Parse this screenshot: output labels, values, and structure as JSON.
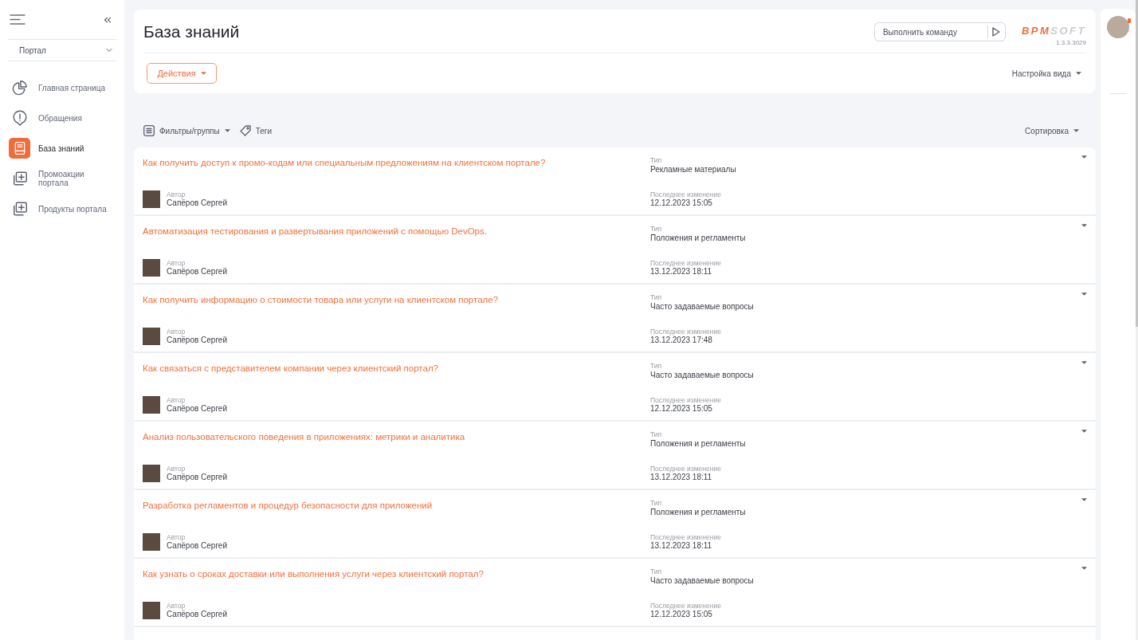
{
  "sidebar": {
    "section": {
      "label": "Портал"
    },
    "items": [
      {
        "label": "Главная страница",
        "kind": "chart",
        "selected": false
      },
      {
        "label": "Обращения",
        "kind": "alert",
        "selected": false
      },
      {
        "label": "База знаний",
        "kind": "book",
        "selected": true
      },
      {
        "label": "Промоакции портала",
        "kind": "stack",
        "selected": false
      },
      {
        "label": "Продукты портала",
        "kind": "stack",
        "selected": false
      }
    ]
  },
  "header": {
    "title": "База знаний",
    "command": {
      "placeholder": "Выполнить команду"
    },
    "logo": {
      "accent": "BPM",
      "rest": "SOFT"
    },
    "version": "1.3.3.3029",
    "actions_button": "Действия",
    "view_settings": "Настройка вида"
  },
  "toolbar": {
    "filters": "Фильтры/группы",
    "tags": "Теги",
    "sort": "Сортировка"
  },
  "articles": [
    {
      "title": "Как получить доступ к промо-кодам или специальным предложениям на клиентском портале?",
      "author_label": "Автор",
      "author": "Сапёров Сергей",
      "type_label": "Тип",
      "type": "Рекламные материалы",
      "modified_label": "Последнее изменение",
      "modified": "12.12.2023 15:05"
    },
    {
      "title": "Автоматизация тестирования и развертывания приложений с помощью DevOps.",
      "author_label": "Автор",
      "author": "Сапёров Сергей",
      "type_label": "Тип",
      "type": "Положения и регламенты",
      "modified_label": "Последнее изменение",
      "modified": "13.12.2023 18:11"
    },
    {
      "title": "Как получить информацию о стоимости товара или услуги на клиентском портале?",
      "author_label": "Автор",
      "author": "Сапёров Сергей",
      "type_label": "Тип",
      "type": "Часто задаваемые вопросы",
      "modified_label": "Последнее изменение",
      "modified": "13.12.2023 17:48"
    },
    {
      "title": "Как связаться с представителем компании через клиентский портал?",
      "author_label": "Автор",
      "author": "Сапёров Сергей",
      "type_label": "Тип",
      "type": "Часто задаваемые вопросы",
      "modified_label": "Последнее изменение",
      "modified": "12.12.2023 15:05"
    },
    {
      "title": "Анализ пользовательского поведения в приложениях: метрики и аналитика",
      "author_label": "Автор",
      "author": "Сапёров Сергей",
      "type_label": "Тип",
      "type": "Положения и регламенты",
      "modified_label": "Последнее изменение",
      "modified": "13.12.2023 18:11"
    },
    {
      "title": "Разработка регламентов и процедур безопасности для приложений",
      "author_label": "Автор",
      "author": "Сапёров Сергей",
      "type_label": "Тип",
      "type": "Положения и регламенты",
      "modified_label": "Последнее изменение",
      "modified": "13.12.2023 18:11"
    },
    {
      "title": "Как узнать о сроках доставки или выполнения услуги через клиентский портал?",
      "author_label": "Автор",
      "author": "Сапёров Сергей",
      "type_label": "Тип",
      "type": "Часто задаваемые вопросы",
      "modified_label": "Последнее изменение",
      "modified": "12.12.2023 15:05"
    }
  ]
}
